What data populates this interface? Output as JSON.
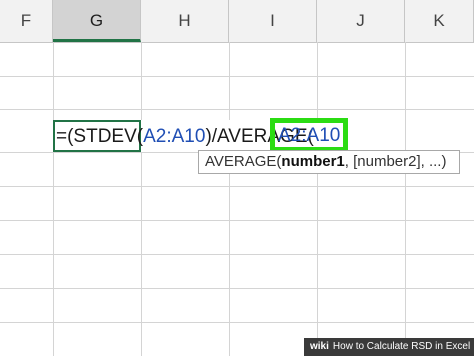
{
  "columns": [
    {
      "label": "F"
    },
    {
      "label": "G",
      "selected": true
    },
    {
      "label": "H"
    },
    {
      "label": "I"
    },
    {
      "label": "J"
    },
    {
      "label": "K"
    }
  ],
  "formula": {
    "eq_open": "=(STDEV(",
    "range1": "A2:A10",
    "close_div": ")/AVERAGE(",
    "range2": "A2:A10"
  },
  "tooltip": {
    "func_name": "AVERAGE(",
    "arg_bold": "number1",
    "arg_rest": ", [number2], ...)"
  },
  "footer": {
    "brand": "wiki",
    "caption": "How to Calculate RSD in Excel"
  },
  "colors": {
    "highlight": "#2bdc13",
    "excel_green": "#217346",
    "ref_blue": "#1f4eb4"
  }
}
